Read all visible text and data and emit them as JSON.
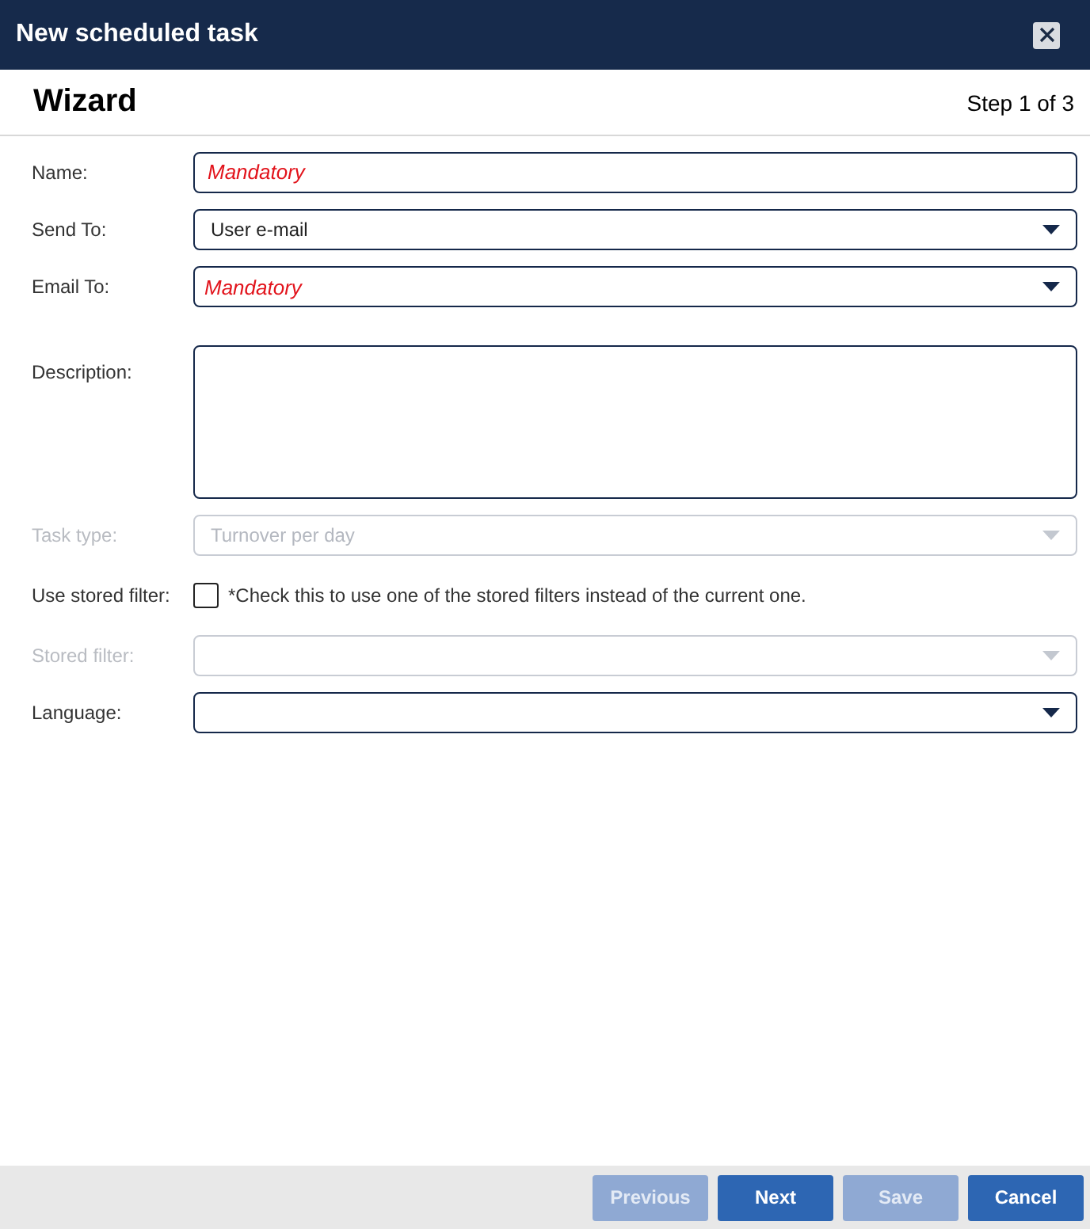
{
  "window": {
    "title": "New scheduled task"
  },
  "header": {
    "title": "Wizard",
    "step": "Step 1 of 3"
  },
  "fields": [
    {
      "kind": "text",
      "label": "Name:",
      "placeholder": "Mandatory",
      "disabled": false
    },
    {
      "kind": "select",
      "label": "Send To:",
      "value": "User e-mail",
      "disabled": false
    },
    {
      "kind": "select",
      "label": "Email To:",
      "placeholder": "Mandatory",
      "disabled": false
    },
    {
      "kind": "textarea",
      "label": "Description:",
      "disabled": false
    },
    {
      "kind": "select",
      "label": "Task type:",
      "value": "Turnover per day",
      "disabled": true
    },
    {
      "kind": "checkbox",
      "label": "Use stored filter:",
      "text": "*Check this to use one of the stored filters instead of the current one.",
      "checked": false,
      "disabled": false
    },
    {
      "kind": "select",
      "label": "Stored filter:",
      "disabled": true
    },
    {
      "kind": "select",
      "label": "Language:",
      "disabled": false
    }
  ],
  "buttons": [
    {
      "label": "Previous",
      "disabled": true
    },
    {
      "label": "Next",
      "disabled": false
    },
    {
      "label": "Save",
      "disabled": true
    },
    {
      "label": "Cancel",
      "disabled": false
    }
  ]
}
